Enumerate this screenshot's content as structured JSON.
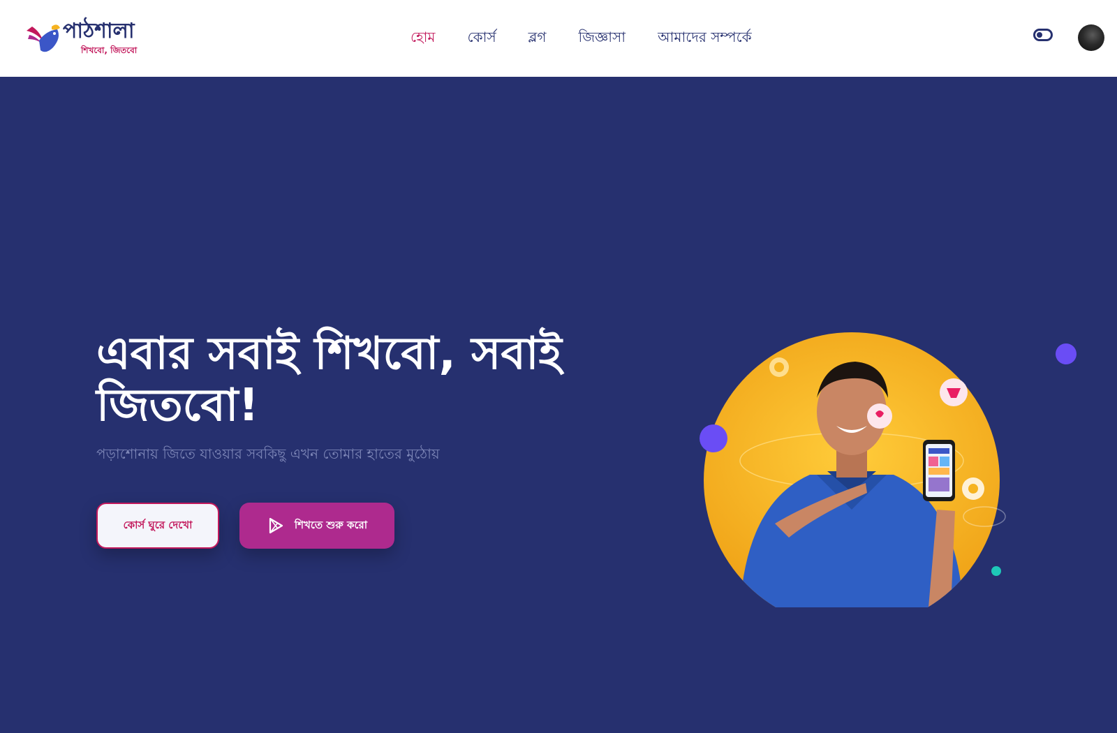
{
  "brand": {
    "name": "পাঠশালা",
    "tagline": "শিখবো, জিতবো",
    "colors": {
      "primary": "#26306f",
      "accent": "#c2185b",
      "button": "#ae2a8e",
      "yellow": "#f6b321"
    }
  },
  "nav": {
    "items": [
      {
        "label": "হোম",
        "active": true
      },
      {
        "label": "কোর্স",
        "active": false
      },
      {
        "label": "ব্লগ",
        "active": false
      },
      {
        "label": "জিজ্ঞাসা",
        "active": false
      },
      {
        "label": "আমাদের সম্পর্কে",
        "active": false
      }
    ],
    "theme_toggle_icon": "toggle-icon",
    "avatar_icon": "user-avatar"
  },
  "hero": {
    "title": "এবার সবাই শিখবো, সবাই জিতবো!",
    "subtitle": "পড়াশোনায় জিতে যাওয়ার সবকিছু এখন তোমার হাতের মুঠোয়",
    "button_courses": "কোর্স ঘুরে দেখো",
    "button_start": "শিখতে শুরু করো",
    "button_start_icon": "play-store-icon",
    "illustration": "person-holding-phone-illustration"
  }
}
